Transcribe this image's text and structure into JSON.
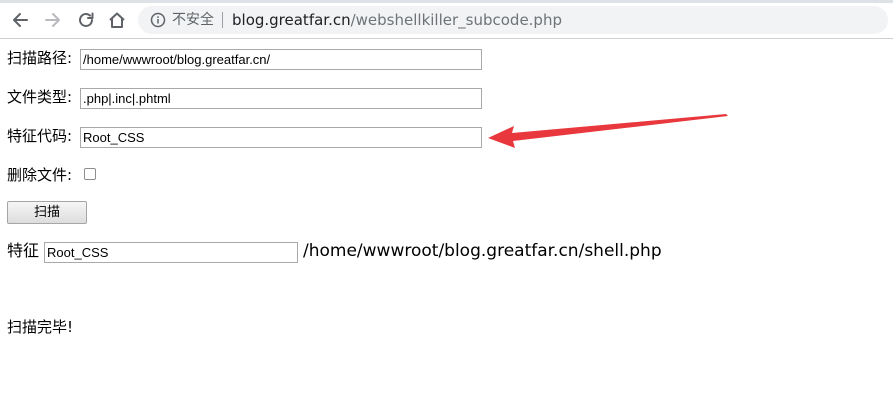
{
  "browser": {
    "security_label": "不安全",
    "url_host": "blog.greatfar.cn",
    "url_path": "/webshellkiller_subcode.php"
  },
  "form": {
    "path_label": "扫描路径:",
    "path_value": "/home/wwwroot/blog.greatfar.cn/",
    "type_label": "文件类型:",
    "type_value": ".php|.inc|.phtml",
    "code_label": "特征代码:",
    "code_value": "Root_CSS",
    "delete_label": "删除文件:",
    "delete_checked": false,
    "scan_button_label": "扫描"
  },
  "result": {
    "feature_label": "特征",
    "feature_value": "Root_CSS",
    "file_path": "/home/wwwroot/blog.greatfar.cn/shell.php"
  },
  "status": {
    "text": "扫描完毕!"
  },
  "colors": {
    "annotation_arrow": "#e8383d"
  },
  "icons": [
    "back-arrow-icon",
    "forward-arrow-icon",
    "reload-icon",
    "home-icon",
    "info-icon"
  ]
}
